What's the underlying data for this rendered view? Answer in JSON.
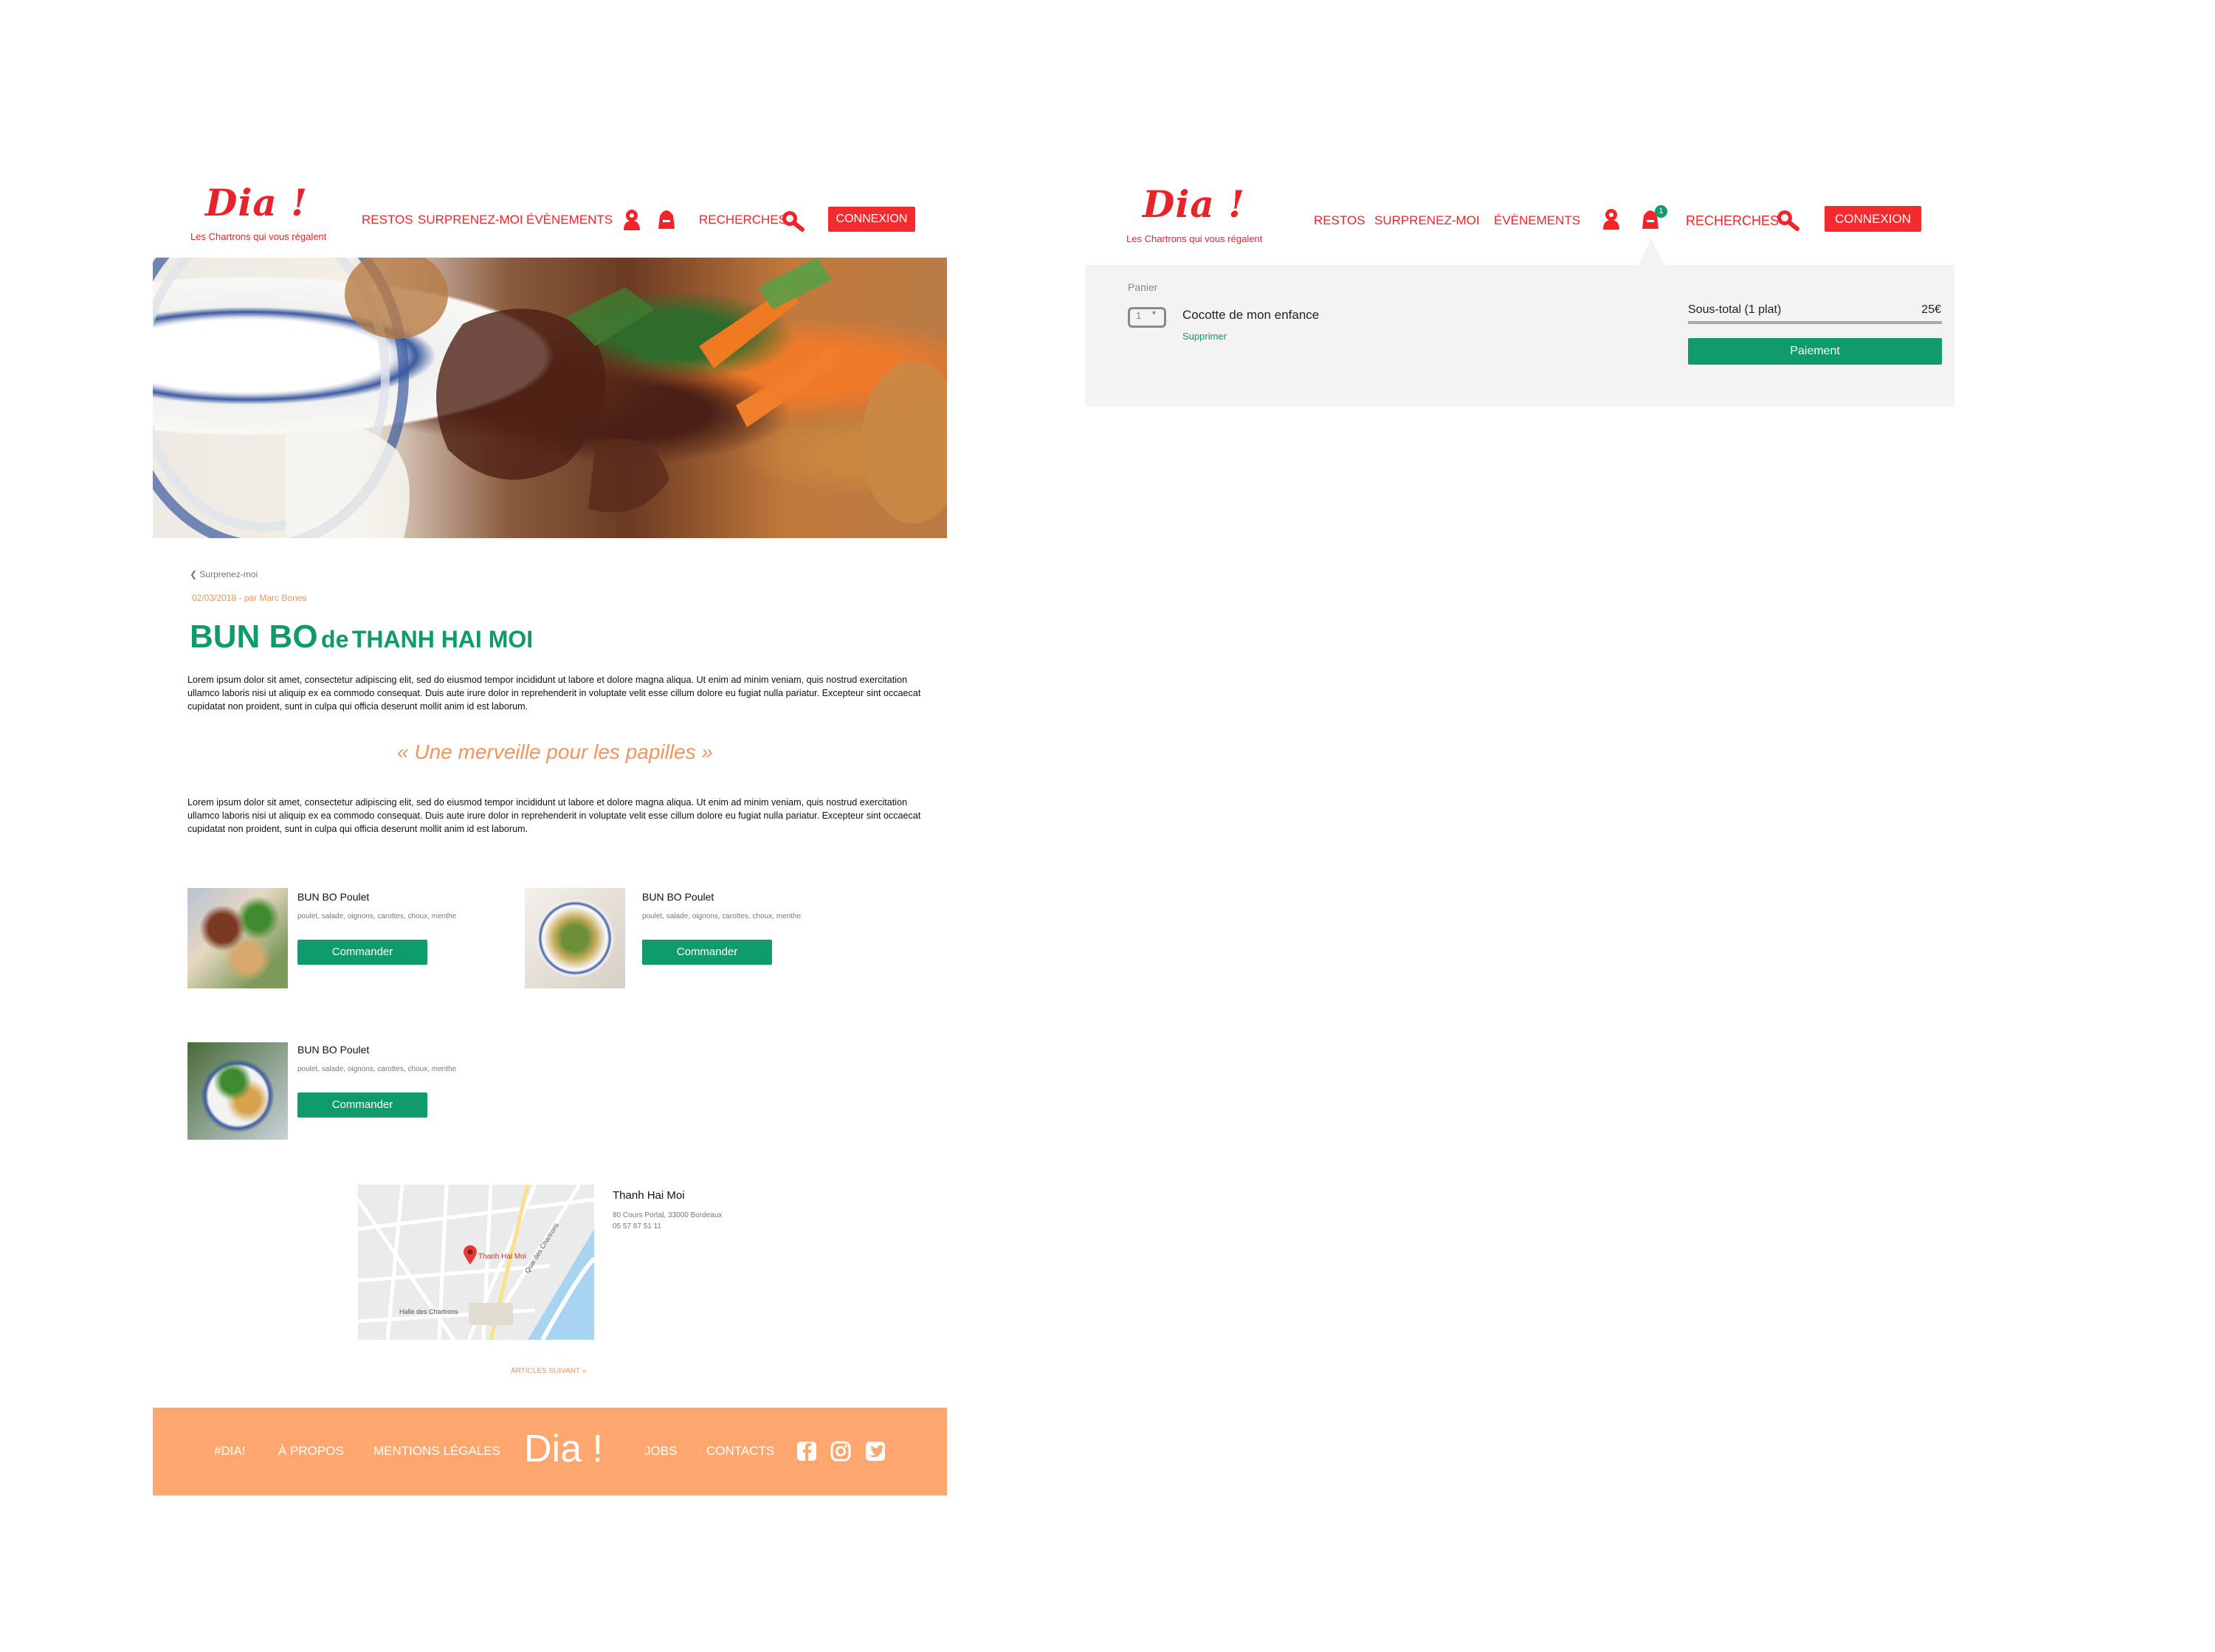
{
  "brand": {
    "logo": "Dia !",
    "tagline": "Les Chartrons qui vous régalent"
  },
  "nav": {
    "restos": "RESTOS",
    "surprenez": "SURPRENEZ-MOI",
    "evenements": "ÉVÈNEMENTS",
    "recherches": "RECHERCHES",
    "connexion": "CONNEXION"
  },
  "article": {
    "breadcrumb": "Surprenez-moi",
    "meta": "02/03/2018 - par Marc Bones",
    "title_main": "BUN BO",
    "title_de": "de",
    "title_resto": "THANH HAI MOI",
    "paragraph1": "Lorem ipsum dolor sit amet, consectetur adipiscing elit, sed do eiusmod tempor incididunt ut labore et dolore magna aliqua. Ut enim ad minim veniam, quis nostrud exercitation ullamco laboris nisi ut aliquip ex ea commodo consequat. Duis aute irure dolor in reprehenderit in voluptate velit esse cillum dolore eu fugiat nulla pariatur. Excepteur sint occaecat cupidatat non proident, sunt in culpa qui officia deserunt mollit anim id est laborum.",
    "quote": "«  Une merveille pour les papilles »",
    "paragraph2": "Lorem ipsum dolor sit amet, consectetur adipiscing elit, sed do eiusmod tempor incididunt ut labore et dolore magna aliqua. Ut enim ad minim veniam, quis nostrud exercitation ullamco laboris nisi ut aliquip ex ea commodo consequat. Duis aute irure dolor in reprehenderit in voluptate velit esse cillum dolore eu fugiat nulla pariatur. Excepteur sint occaecat cupidatat non proident, sunt in culpa qui officia deserunt mollit anim id est laborum.",
    "next_article": "ARTICLES SUIVANT"
  },
  "dishes": [
    {
      "name": "BUN BO Poulet",
      "ingredients": "poulet, salade, oignons, carottes, choux, menthe",
      "button": "Commander"
    },
    {
      "name": "BUN BO Poulet",
      "ingredients": "poulet, salade, oignons, carottes, choux, menthe",
      "button": "Commander"
    },
    {
      "name": "BUN BO Poulet",
      "ingredients": "poulet, salade, oignons, carottes, choux, menthe",
      "button": "Commander"
    }
  ],
  "restaurant": {
    "name": "Thanh Hai Moi",
    "address": "80 Cours Portal, 33000 Bordeaux",
    "phone": "05 57 87 51 11",
    "map_pin_label": "Thanh Hai Moi",
    "map_label_quai": "Quai des Chartrons",
    "map_label_halle": "Halle des Chartrons"
  },
  "footer": {
    "dia": "#DIA!",
    "apropos": "À PROPOS",
    "mentions": "MENTIONS LÉGALES",
    "logo": "Dia !",
    "jobs": "JOBS",
    "contacts": "CONTACTS"
  },
  "cart": {
    "badge": "1",
    "title": "Panier",
    "quantity": "1",
    "item_name": "Cocotte de mon enfance",
    "remove": "Supprimer",
    "subtotal_label": "Sous-total (1 plat)",
    "subtotal_value": "25€",
    "pay_button": "Paiement"
  },
  "colors": {
    "brand_red": "#f2242a",
    "brand_green": "#0f9b6b",
    "footer_orange": "#fda76f",
    "accent_orange": "#f4935a"
  }
}
